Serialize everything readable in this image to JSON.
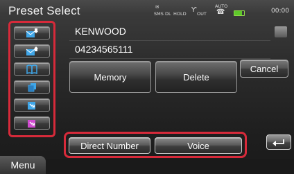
{
  "header": {
    "title": "Preset Select",
    "status": {
      "sms_label": "SMS",
      "dl_label": "DL",
      "hold_label": "HOLD",
      "out_label": "OUT",
      "auto_label": "AUTO",
      "battery_color": "#5ec82a"
    },
    "clock": "00:00"
  },
  "left_icons": [
    {
      "name": "inbox-download-icon",
      "color": "#3fa6e8"
    },
    {
      "name": "outbox-upload-icon",
      "color": "#3fa6e8"
    },
    {
      "name": "phonebook-icon",
      "color": "#3fa6e8"
    },
    {
      "name": "document-copy-icon",
      "color": "#3fa6e8"
    },
    {
      "name": "incoming-call-icon",
      "color": "#3fa6e8"
    },
    {
      "name": "missed-call-icon",
      "color": "#d04bd0"
    }
  ],
  "entry": {
    "name": "KENWOOD",
    "number": "04234565111"
  },
  "actions": {
    "memory_label": "Memory",
    "delete_label": "Delete",
    "cancel_label": "Cancel"
  },
  "bottom": {
    "direct_number_label": "Direct Number",
    "voice_label": "Voice",
    "back_icon": "return-arrow-icon",
    "menu_label": "Menu"
  },
  "colors": {
    "highlight": "#d72a3a"
  }
}
